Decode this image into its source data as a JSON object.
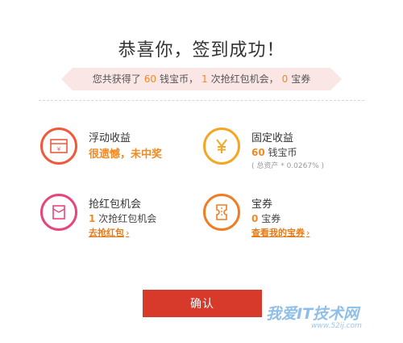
{
  "header": {
    "title": "恭喜你，签到成功！"
  },
  "summary": {
    "prefix": "您共获得了",
    "coins": "60",
    "coins_unit": "钱宝币，",
    "chances": "1",
    "chances_unit": "次抢红包机会，",
    "coupons": "0",
    "coupons_unit": "宝券"
  },
  "rewards": {
    "floating": {
      "label": "浮动收益",
      "result": "很遗憾，未中奖"
    },
    "fixed": {
      "label": "固定收益",
      "amount": "60",
      "amount_unit": "钱宝币",
      "note": "( 总资产 * 0.0267% )"
    },
    "redpacket": {
      "label": "抢红包机会",
      "count": "1",
      "count_unit": "次抢红包机会",
      "link": "去抢红包"
    },
    "coupon": {
      "label": "宝券",
      "count": "0",
      "count_unit": "宝券",
      "link": "查看我的宝券"
    }
  },
  "actions": {
    "confirm": "确认"
  },
  "watermark": {
    "text": "我爱IT技术网",
    "url": "www.52ij.com"
  },
  "colors": {
    "accent": "#f08a24",
    "button": "#d7392b",
    "ribbon": "#fbe6e6"
  },
  "icons": {
    "floating": "gift-box-icon",
    "fixed": "yen-icon",
    "redpacket": "red-envelope-icon",
    "coupon": "ticket-icon",
    "chevron": "chevron-right-icon"
  }
}
